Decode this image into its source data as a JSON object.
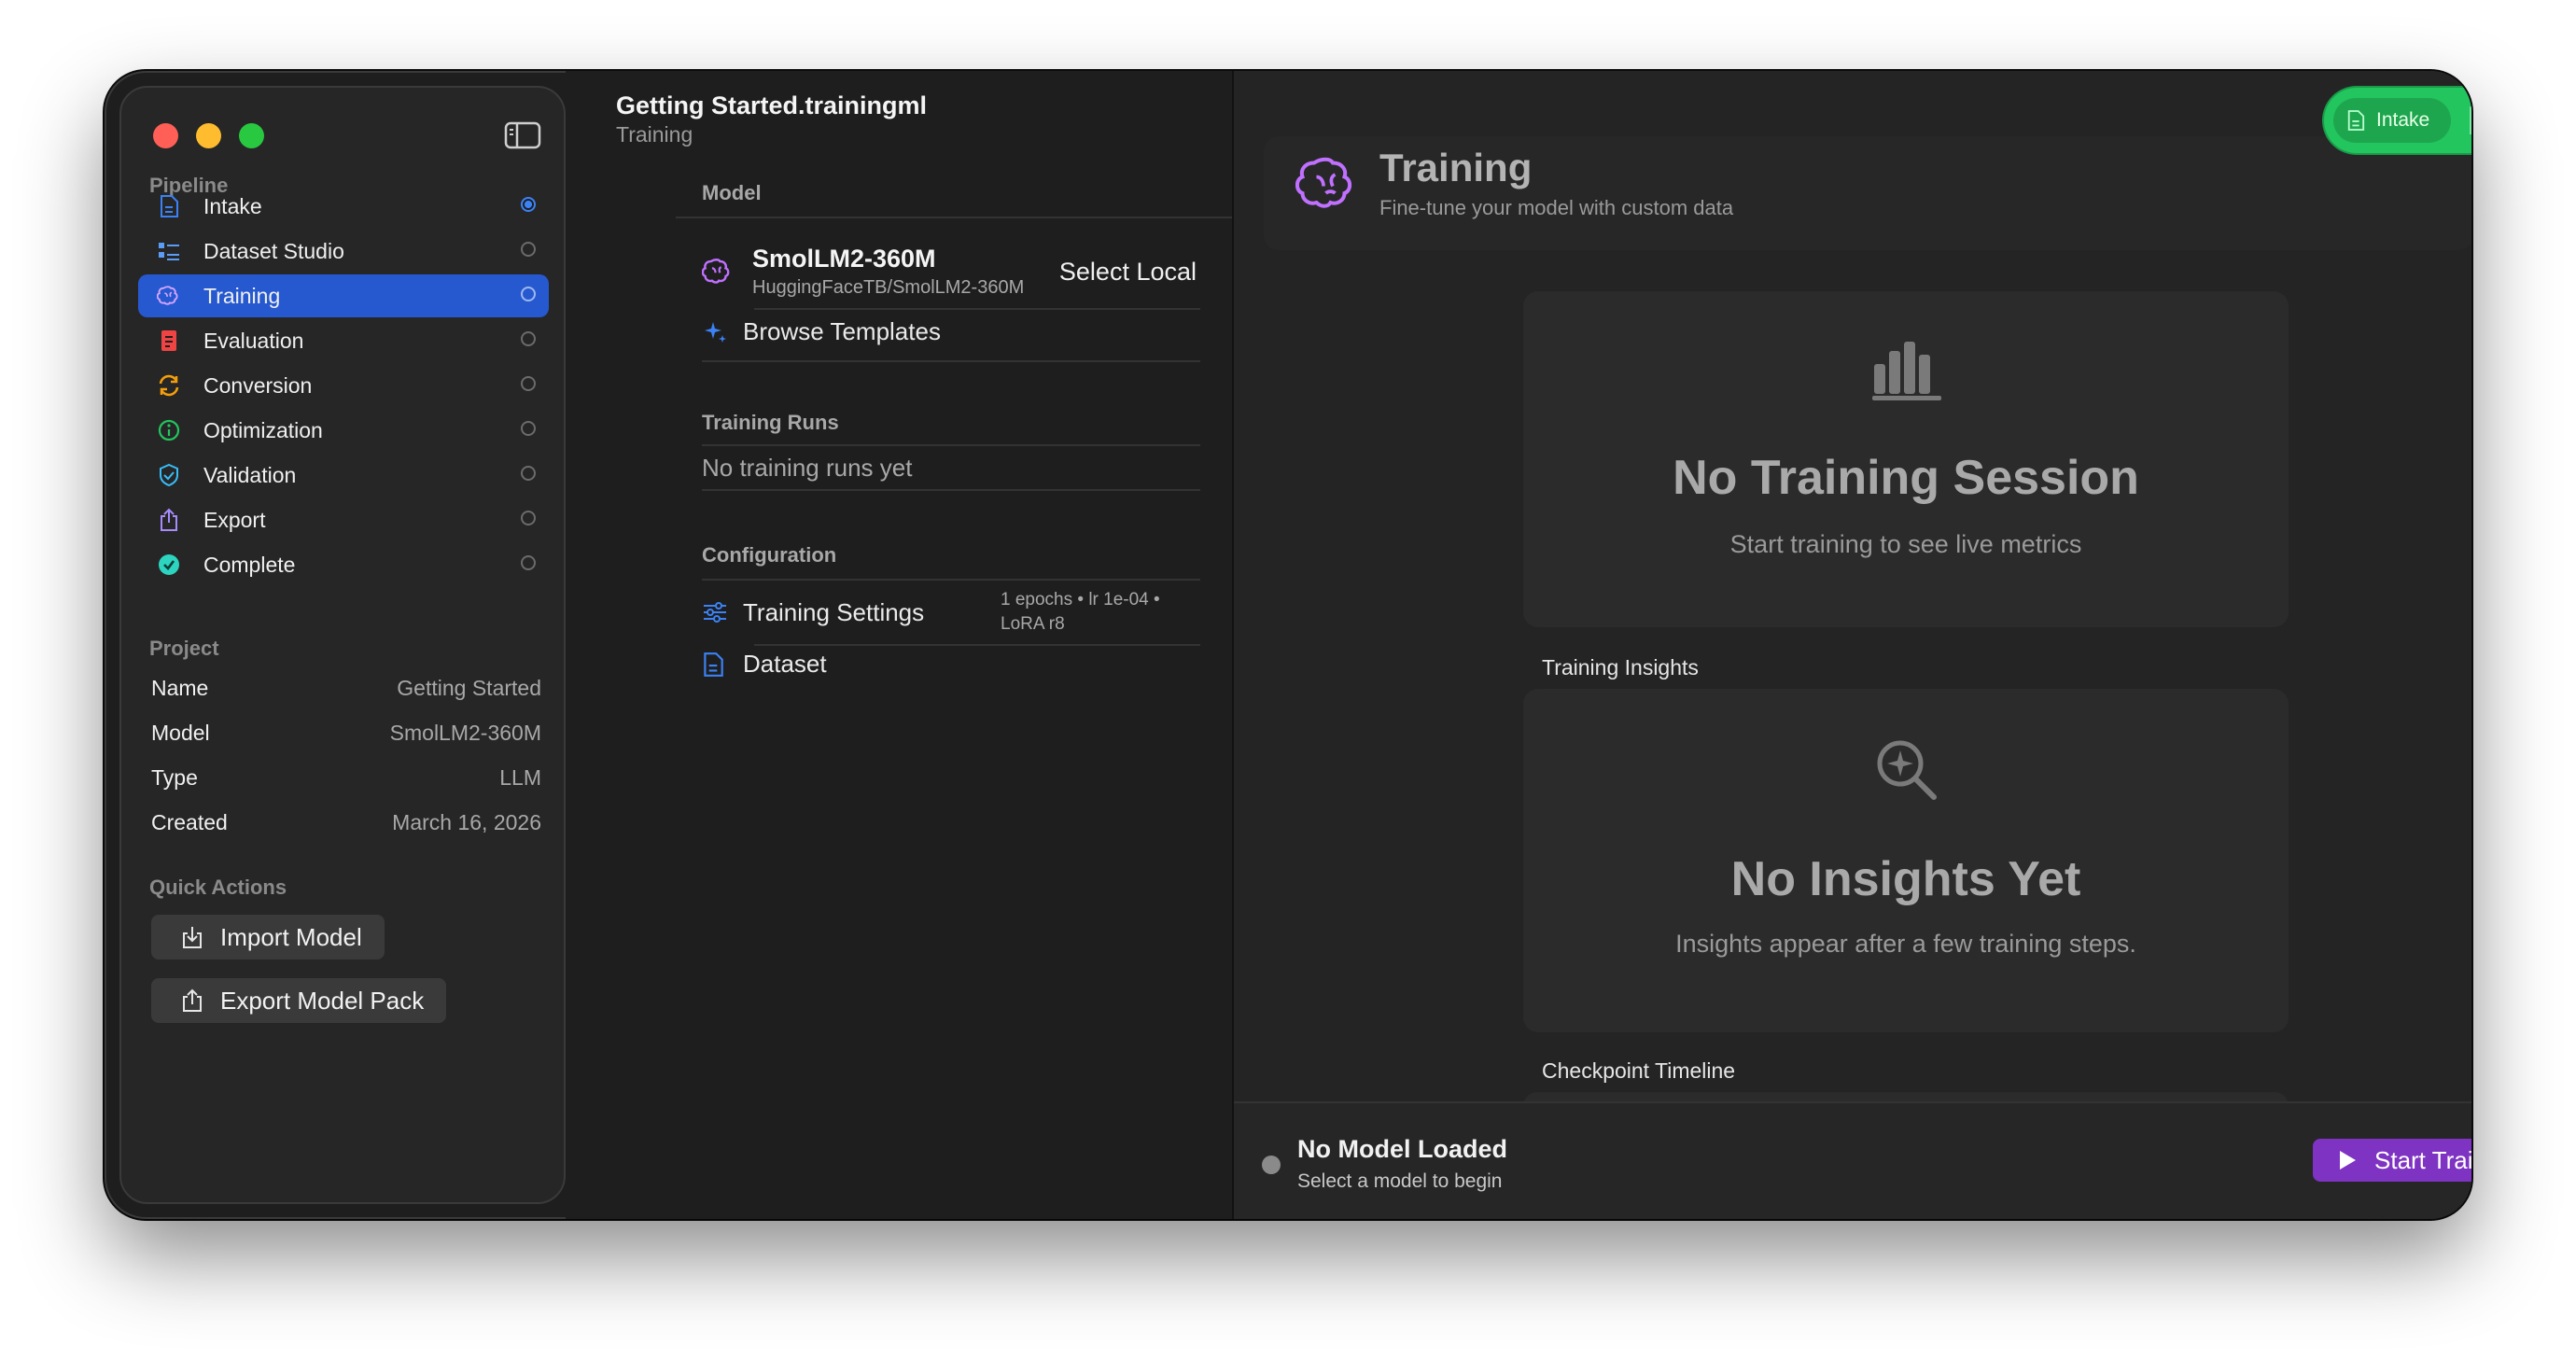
{
  "sidebar": {
    "pipeline_label": "Pipeline",
    "items": [
      {
        "label": "Intake",
        "icon": "document-icon",
        "color": "#3b82f6",
        "status": "filled"
      },
      {
        "label": "Dataset Studio",
        "icon": "list-icon",
        "color": "#5b9cf6",
        "status": "empty"
      },
      {
        "label": "Training",
        "icon": "brain-icon",
        "color": "#c070ff",
        "status": "empty",
        "active": true
      },
      {
        "label": "Evaluation",
        "icon": "report-icon",
        "color": "#ef4444",
        "status": "empty"
      },
      {
        "label": "Conversion",
        "icon": "cycle-icon",
        "color": "#f59e0b",
        "status": "empty"
      },
      {
        "label": "Optimization",
        "icon": "gauge-icon",
        "color": "#22c55e",
        "status": "empty"
      },
      {
        "label": "Validation",
        "icon": "shield-icon",
        "color": "#38bdf8",
        "status": "empty"
      },
      {
        "label": "Export",
        "icon": "share-icon",
        "color": "#a78bfa",
        "status": "empty"
      },
      {
        "label": "Complete",
        "icon": "checkmark-icon",
        "color": "#2dd4bf",
        "status": "empty"
      }
    ],
    "project_label": "Project",
    "project": [
      {
        "key": "Name",
        "value": "Getting Started"
      },
      {
        "key": "Model",
        "value": "SmolLM2-360M"
      },
      {
        "key": "Type",
        "value": "LLM"
      },
      {
        "key": "Created",
        "value": "March 16, 2026"
      }
    ],
    "quick_actions_label": "Quick Actions",
    "import_label": "Import Model",
    "export_label": "Export Model Pack"
  },
  "middle": {
    "title": "Getting Started.trainingml",
    "subtitle": "Training",
    "model_section": "Model",
    "model_name": "SmolLM2-360M",
    "model_repo": "HuggingFaceTB/SmolLM2-360M",
    "select_local": "Select Local",
    "browse_templates": "Browse Templates",
    "runs_section": "Training Runs",
    "no_runs": "No training runs yet",
    "config_section": "Configuration",
    "training_settings": "Training Settings",
    "settings_summary_1": "1 epochs • lr 1e-04 •",
    "settings_summary_2": "LoRA r8",
    "dataset": "Dataset"
  },
  "right": {
    "title": "Training",
    "subtitle": "Fine-tune your model with custom data",
    "toolbar_intake": "Intake",
    "empty_title": "No Training Session",
    "empty_sub": "Start training to see live metrics",
    "insights_label": "Training Insights",
    "insights_title": "No Insights Yet",
    "insights_sub": "Insights appear after a few training steps.",
    "checkpoint_label": "Checkpoint Timeline",
    "status_title": "No Model Loaded",
    "status_sub": "Select a model to begin",
    "start_button": "Start Training"
  },
  "colors": {
    "accent_blue": "#2659d0",
    "toolbar_green": "#22c55e",
    "start_purple": "#7e33c2",
    "brain_purple": "#c070ff"
  }
}
